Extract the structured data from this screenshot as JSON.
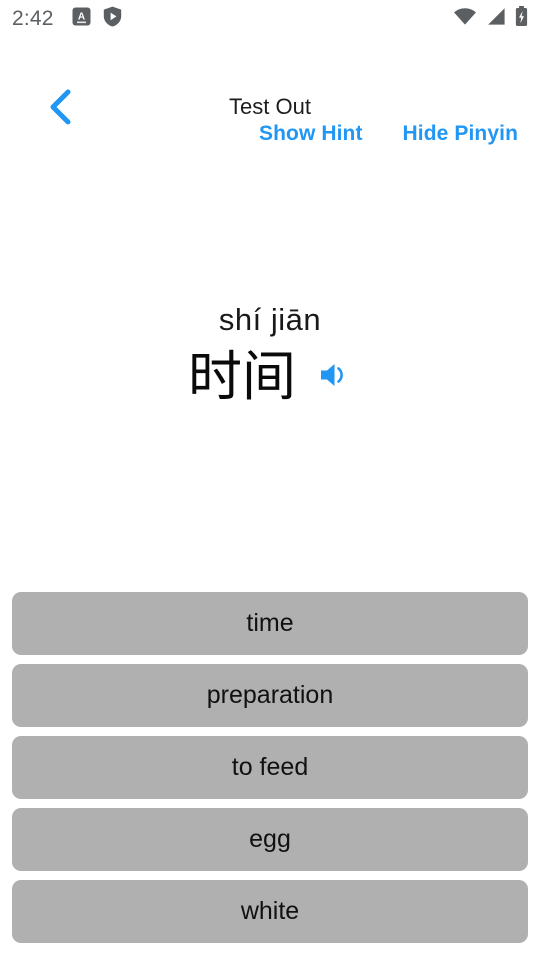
{
  "status_bar": {
    "time": "2:42",
    "left_icons": [
      "screenshot-a-icon",
      "shield-play-icon"
    ],
    "right_icons": [
      "wifi-icon",
      "cell-signal-icon",
      "battery-charging-icon"
    ]
  },
  "header": {
    "back_icon": "chevron-left-icon",
    "title": "Test Out"
  },
  "actions": {
    "show_hint_label": "Show Hint",
    "hide_pinyin_label": "Hide Pinyin"
  },
  "word_card": {
    "pinyin": "shí jiān",
    "hanzi": "时间",
    "speaker_icon": "speaker-volume-icon"
  },
  "options": [
    {
      "label": "time"
    },
    {
      "label": "preparation"
    },
    {
      "label": "to feed"
    },
    {
      "label": "egg"
    },
    {
      "label": "white"
    }
  ],
  "colors": {
    "accent_blue": "#2196f3",
    "option_gray": "#b0b0b0",
    "status_gray": "#5c5f61",
    "text_dark": "#111111"
  }
}
